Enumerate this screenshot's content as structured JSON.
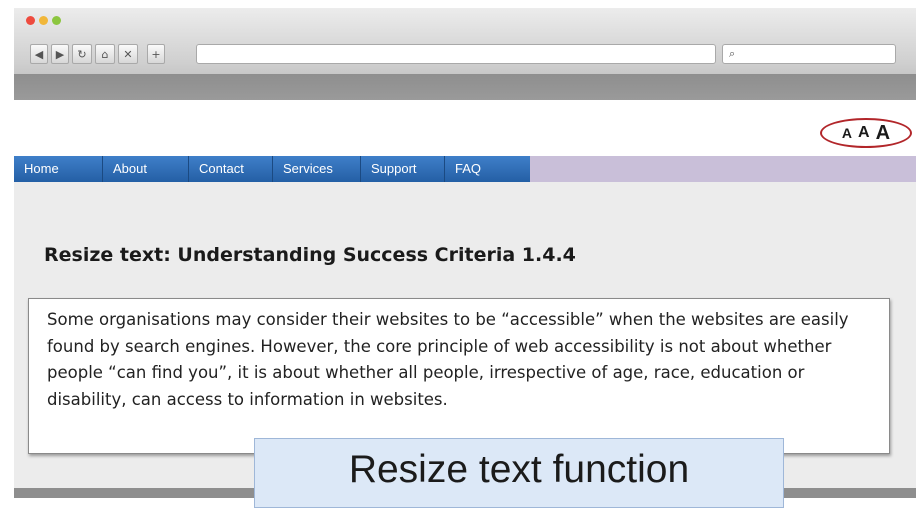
{
  "browser": {
    "window_controls": [
      "close",
      "minimize",
      "zoom"
    ],
    "toolbar_buttons": [
      {
        "icon": "back-icon",
        "glyph": "◀"
      },
      {
        "icon": "forward-icon",
        "glyph": "▶"
      },
      {
        "icon": "reload-icon",
        "glyph": "↻"
      },
      {
        "icon": "home-icon",
        "glyph": "⌂"
      },
      {
        "icon": "stop-icon",
        "glyph": "✕"
      },
      {
        "icon": "new-tab-icon",
        "glyph": "+"
      }
    ],
    "address_value": "",
    "search_icon": "search-icon"
  },
  "text_resizer": {
    "small": "A",
    "medium": "A",
    "large": "A",
    "highlight_color": "#b2262a"
  },
  "menu": {
    "items": [
      "Home",
      "About",
      "Contact",
      "Services",
      "Support",
      "FAQ"
    ],
    "color": "#2f6db5",
    "bar_color": "#c9bfd9"
  },
  "main": {
    "heading": "Resize text: Understanding Success Criteria 1.4.4",
    "body": "Some organisations may consider their websites to be “accessible” when the websites are easily found by search engines. However, the core principle of web accessibility is not about whether people “can find you”, it is about whether all people, irrespective of age, race, education or disability, can access to information in websites."
  },
  "overlay": {
    "label": "Resize text function"
  }
}
